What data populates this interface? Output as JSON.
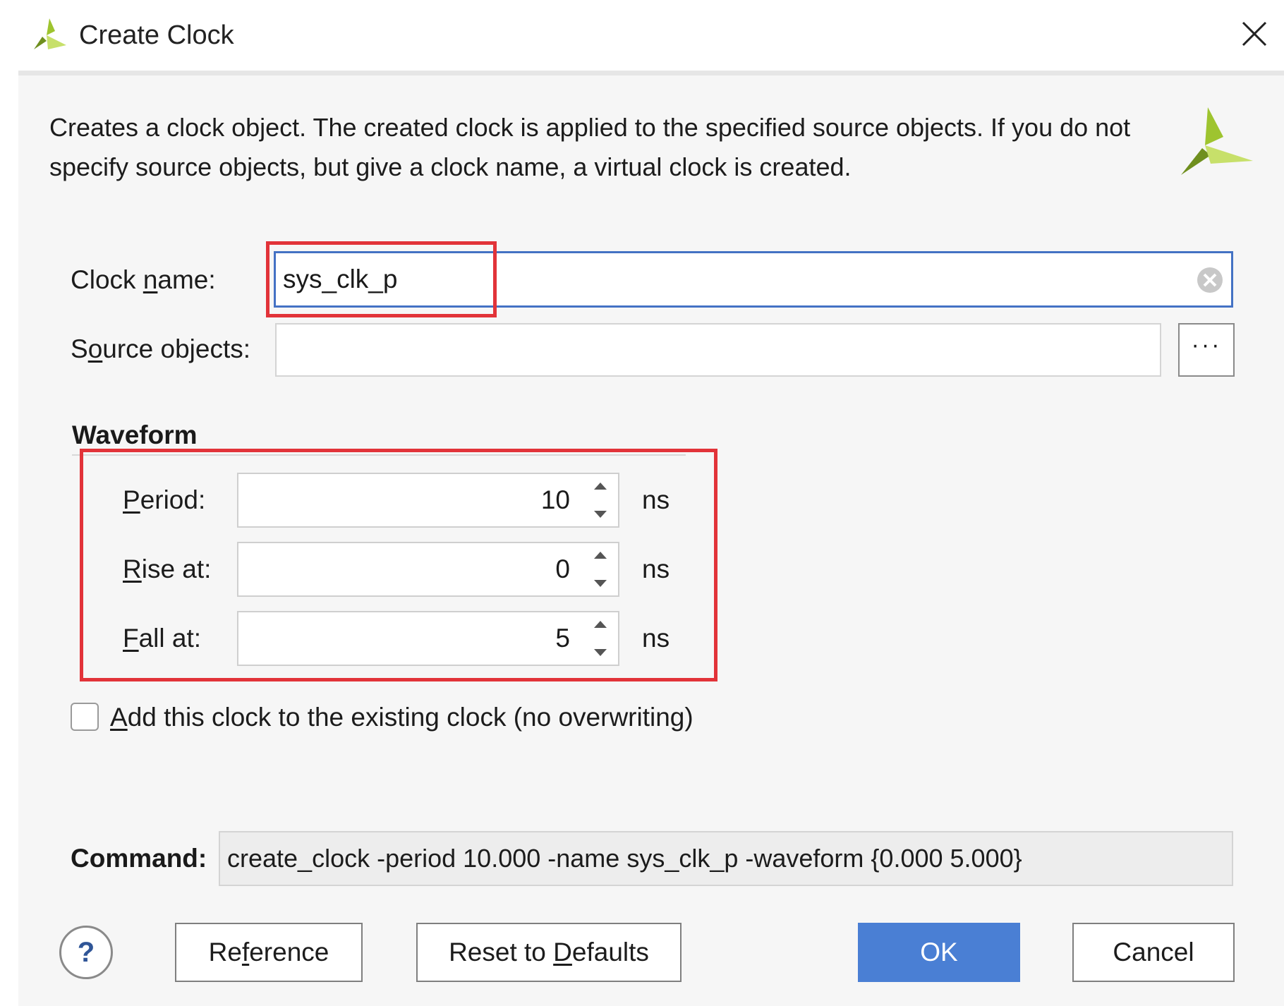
{
  "window": {
    "title": "Create Clock",
    "icons": {
      "logo": "vivado-logo-icon",
      "close": "close-icon"
    }
  },
  "description": "Creates a clock object. The created clock is applied to the specified source objects. If you do not specify source objects, but give a clock name, a virtual clock is created.",
  "form": {
    "clock_name": {
      "label_pre": "Clock ",
      "label_key": "n",
      "label_post": "ame:",
      "value": "sys_clk_p"
    },
    "source_objects": {
      "label_pre": "S",
      "label_key": "o",
      "label_post": "urce objects:",
      "value": "",
      "browse_label": "···"
    }
  },
  "waveform": {
    "heading": "Waveform",
    "period": {
      "label_key": "P",
      "label_post": "eriod:",
      "value": "10",
      "unit": "ns"
    },
    "rise": {
      "label_key": "R",
      "label_post": "ise at:",
      "value": "0",
      "unit": "ns"
    },
    "fall": {
      "label_key": "F",
      "label_post": "all at:",
      "value": "5",
      "unit": "ns"
    }
  },
  "add_clock": {
    "checked": false,
    "label_key": "A",
    "label_post": "dd this clock to the existing clock (no overwriting)"
  },
  "command": {
    "label": "Command:",
    "value": "create_clock -period 10.000 -name sys_clk_p -waveform {0.000 5.000}"
  },
  "buttons": {
    "help": "?",
    "reference_pre": "Re",
    "reference_key": "f",
    "reference_post": "erence",
    "reset_pre": "Reset to ",
    "reset_key": "D",
    "reset_post": "efaults",
    "ok": "OK",
    "cancel": "Cancel"
  },
  "colors": {
    "accent": "#4a7fd4",
    "focus_border": "#4472c4",
    "highlight_annotation": "#e23339",
    "dialog_background": "#f6f6f6"
  }
}
